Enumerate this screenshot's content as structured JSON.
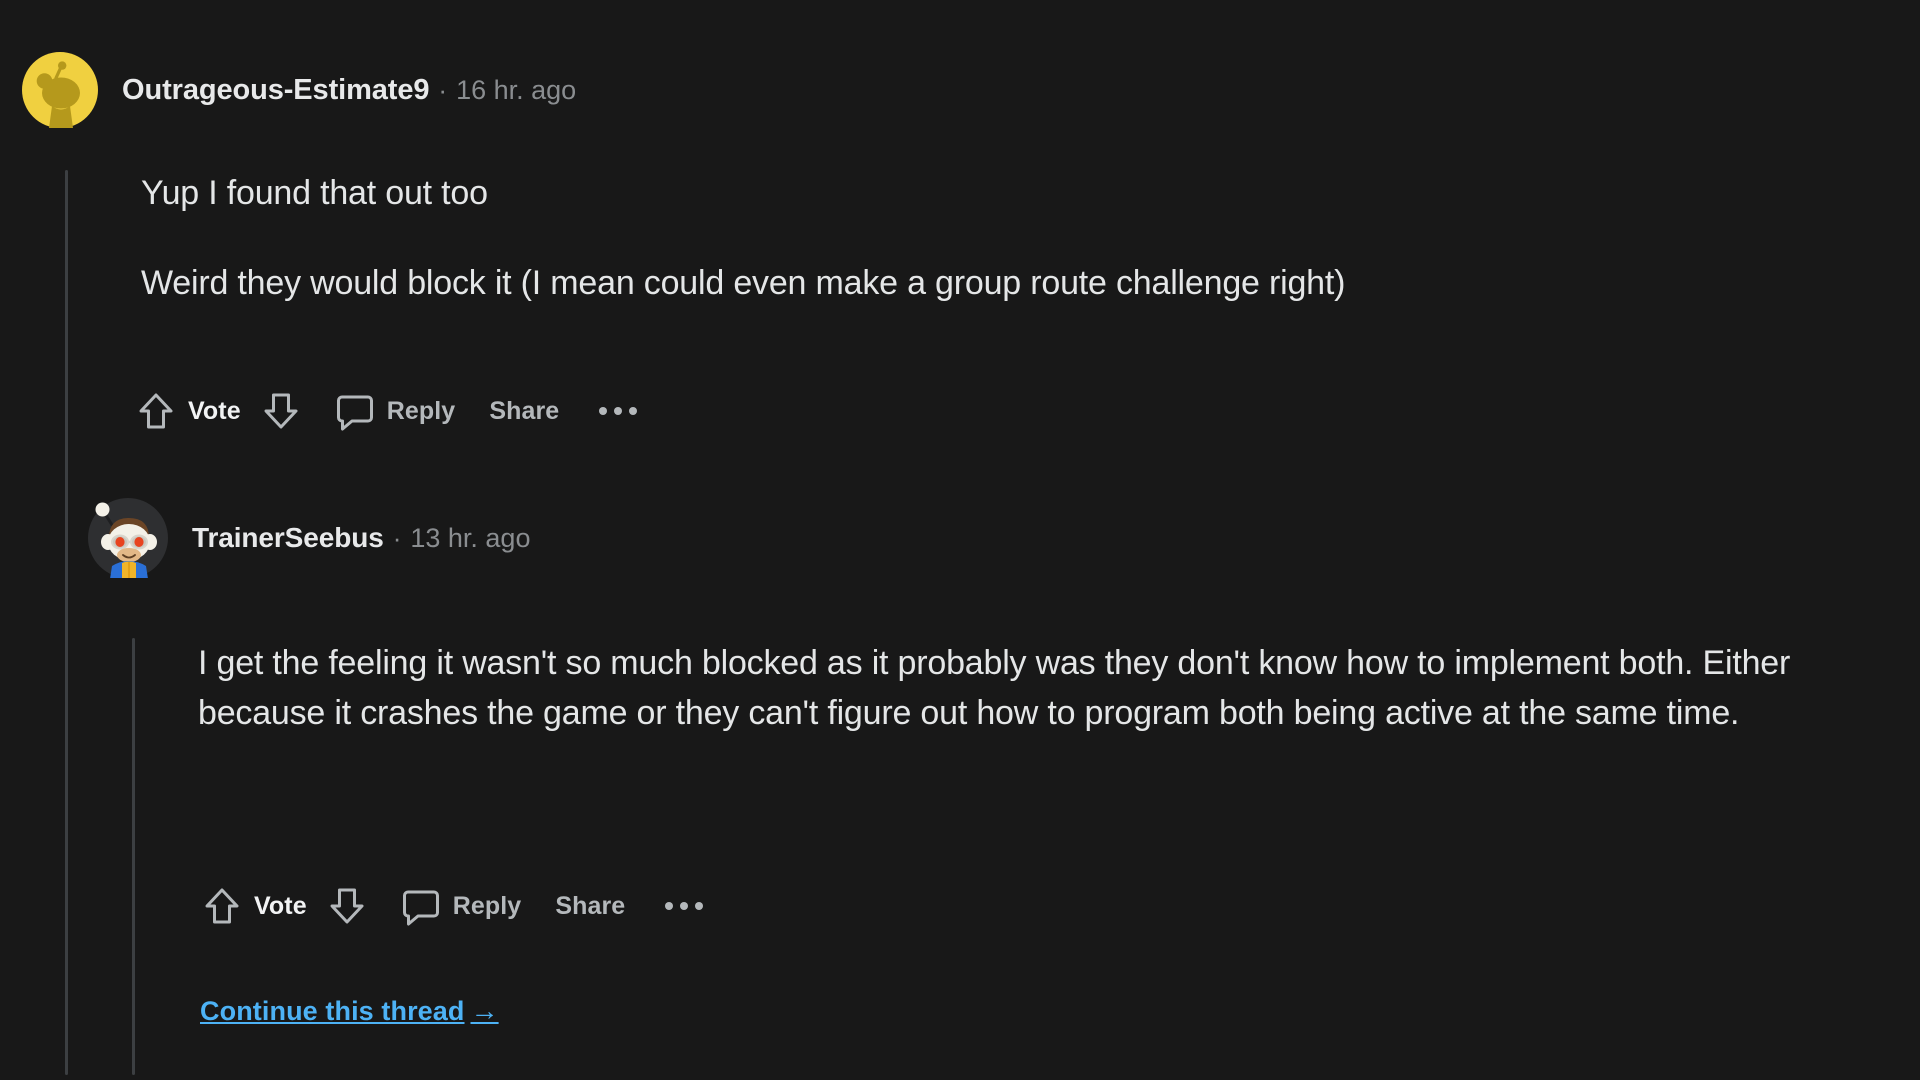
{
  "theme": {
    "background": "#181818",
    "text_primary": "#e4e6e7",
    "text_muted": "#8a8d90",
    "thread_line": "#3c3f42",
    "link_blue": "#4db2f5",
    "icon_stroke": "#b4b8bb",
    "avatar1_bg": "#f0d040",
    "avatar1_fg": "#b5991c",
    "avatar2_bg": "#2e2f31"
  },
  "comments": [
    {
      "id": "comment-level-1",
      "avatar_name": "avatar-snoo-yellow",
      "username": "Outrageous-Estimate9",
      "separator": "·",
      "timestamp": "16 hr. ago",
      "paragraphs": [
        "Yup I found that out too",
        "Weird they would block it (I mean could even make a group route challenge right)"
      ],
      "actions": {
        "upvote_icon": "upvote-arrow-icon",
        "vote_label": "Vote",
        "downvote_icon": "downvote-arrow-icon",
        "comment_icon": "comment-bubble-icon",
        "reply_label": "Reply",
        "share_label": "Share",
        "more_icon": "overflow-menu-icon"
      }
    },
    {
      "id": "comment-level-2",
      "avatar_name": "avatar-snoo-trainer",
      "username": "TrainerSeebus",
      "separator": "·",
      "timestamp": "13 hr. ago",
      "paragraphs": [
        "I get the feeling it wasn't so much blocked as it probably was they don't know how to implement both. Either because it crashes the game or they can't figure out how to program both being active at the same time."
      ],
      "actions": {
        "upvote_icon": "upvote-arrow-icon",
        "vote_label": "Vote",
        "downvote_icon": "downvote-arrow-icon",
        "comment_icon": "comment-bubble-icon",
        "reply_label": "Reply",
        "share_label": "Share",
        "more_icon": "overflow-menu-icon"
      }
    }
  ],
  "continue_thread": {
    "label": "Continue this thread",
    "arrow": "→"
  }
}
